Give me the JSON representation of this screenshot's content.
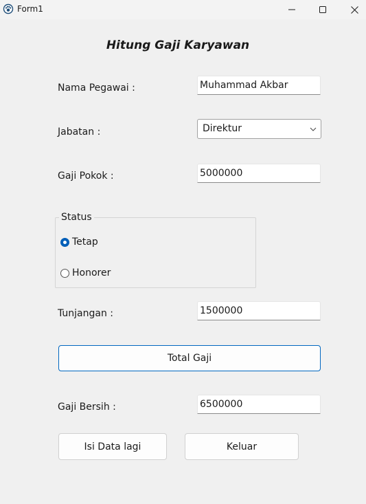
{
  "window": {
    "title": "Form1",
    "controls": {
      "minimize_icon": "minimize-icon",
      "maximize_icon": "maximize-icon",
      "close_icon": "close-icon"
    }
  },
  "form": {
    "heading": "Hitung Gaji Karyawan",
    "nama": {
      "label": "Nama Pegawai :",
      "value": "Muhammad Akbar"
    },
    "jabatan": {
      "label": "Jabatan :",
      "selected": "Direktur"
    },
    "gaji_pokok": {
      "label": "Gaji Pokok :",
      "value": "5000000"
    },
    "status": {
      "caption": "Status",
      "options": [
        {
          "label": "Tetap",
          "checked": true
        },
        {
          "label": "Honorer",
          "checked": false
        }
      ]
    },
    "tunjangan": {
      "label": "Tunjangan :",
      "value": "1500000"
    },
    "total_button": "Total Gaji",
    "gaji_bersih": {
      "label": "Gaji Bersih :",
      "value": "6500000"
    },
    "reset_button": "Isi Data lagi",
    "exit_button": "Keluar"
  },
  "colors": {
    "accent": "#005fb8",
    "background": "#f0f0f0",
    "primary_border": "#0067c0"
  }
}
